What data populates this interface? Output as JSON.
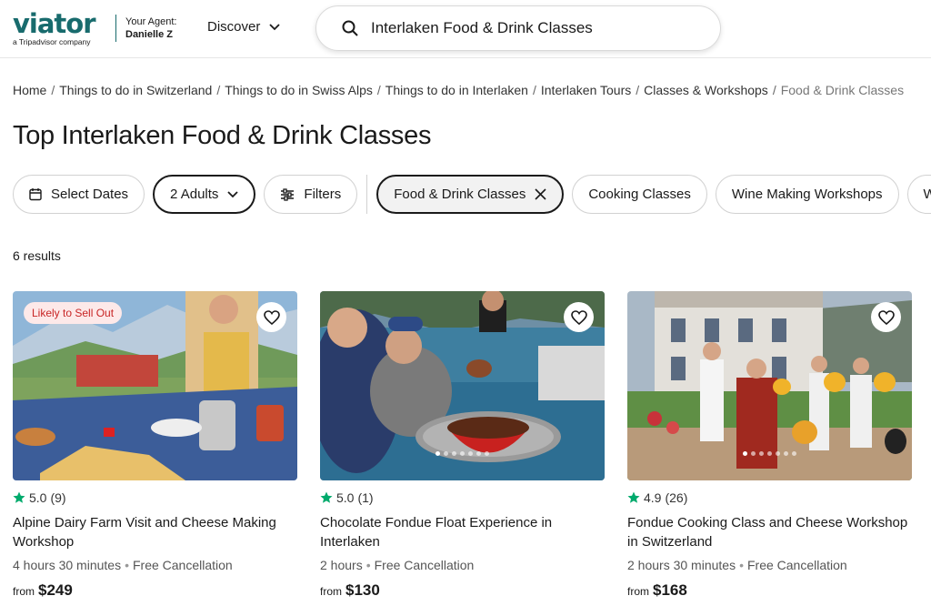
{
  "header": {
    "logo_text": "viator",
    "logo_subtitle": "a Tripadvisor company",
    "agent_label": "Your Agent:",
    "agent_name": "Danielle Z",
    "discover_label": "Discover",
    "search_value": "Interlaken Food & Drink Classes"
  },
  "breadcrumb": {
    "items": [
      "Home",
      "Things to do in Switzerland",
      "Things to do in Swiss Alps",
      "Things to do in Interlaken",
      "Interlaken Tours",
      "Classes & Workshops"
    ],
    "current": "Food & Drink Classes",
    "separator": "/"
  },
  "page_title": "Top Interlaken Food & Drink Classes",
  "filters": {
    "select_dates": "Select Dates",
    "adults": "2 Adults",
    "filters": "Filters",
    "categories": [
      "Food & Drink Classes",
      "Cooking Classes",
      "Wine Making Workshops",
      "Wi"
    ]
  },
  "results_count": "6 results",
  "cards": [
    {
      "badge": "Likely to Sell Out",
      "rating": "5.0",
      "reviews": "(9)",
      "title": "Alpine Dairy Farm Visit and Cheese Making Workshop",
      "duration": "4 hours 30 minutes",
      "cancellation": "Free Cancellation",
      "from": "from",
      "price": "$249"
    },
    {
      "rating": "5.0",
      "reviews": "(1)",
      "title": "Chocolate Fondue Float Experience in Interlaken",
      "duration": "2 hours",
      "cancellation": "Free Cancellation",
      "from": "from",
      "price": "$130"
    },
    {
      "rating": "4.9",
      "reviews": "(26)",
      "title": "Fondue Cooking Class and Cheese Workshop in Switzerland",
      "duration": "2 hours 30 minutes",
      "cancellation": "Free Cancellation",
      "from": "from",
      "price": "$168"
    }
  ],
  "colors": {
    "brand": "#186b6d",
    "star": "#00aa6c",
    "badge_text": "#c82525",
    "badge_bg": "#fde9e9"
  },
  "icons": [
    "search-icon",
    "chevron-down-icon",
    "calendar-icon",
    "sliders-icon",
    "close-icon",
    "heart-icon",
    "star-icon"
  ]
}
